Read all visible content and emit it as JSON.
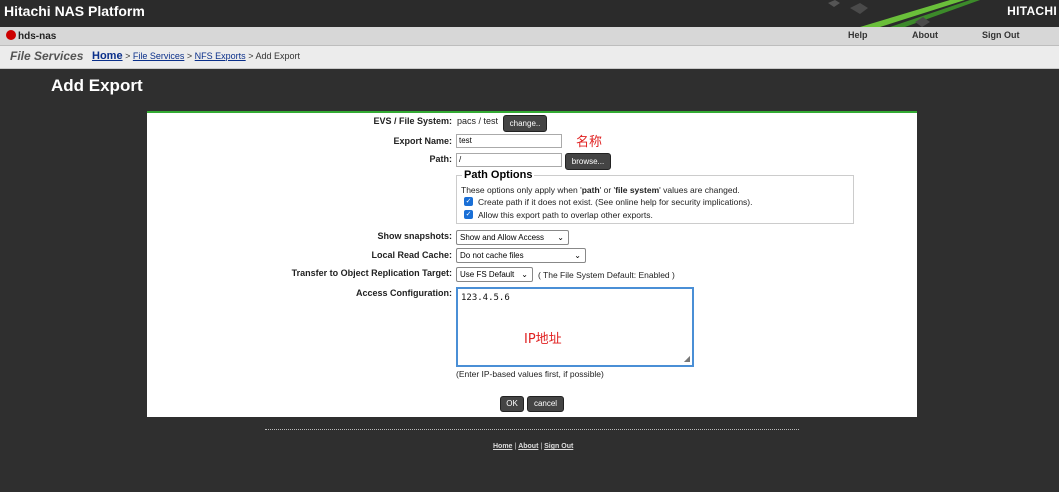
{
  "app": {
    "title": "Hitachi NAS Platform",
    "brand": "HITACHI"
  },
  "nav": {
    "server": "hds-nas",
    "help": "Help",
    "about": "About",
    "signout": "Sign Out"
  },
  "breadcrumb": {
    "section": "File Services",
    "home": "Home",
    "file_services": "File Services",
    "nfs_exports": "NFS Exports",
    "current": "Add Export",
    "sep": ">"
  },
  "page": {
    "title": "Add Export"
  },
  "form": {
    "evs_label": "EVS / File System:",
    "evs_value": "pacs /  test",
    "change_button": "change..",
    "export_name_label": "Export Name:",
    "export_name_value": "test",
    "export_name_annotation": "名称",
    "path_label": "Path:",
    "path_value": "/",
    "browse_button": "browse...",
    "path_options": {
      "legend": "Path Options",
      "note_before": "These options only apply when '",
      "note_path": "path",
      "note_mid": "' or '",
      "note_fs": "file system",
      "note_after": "' values are changed.",
      "create_path": "Create path if it does not exist. (See online help for security implications).",
      "create_path_checked": true,
      "allow_overlap": "Allow this export path to overlap other exports.",
      "allow_overlap_checked": true
    },
    "snapshots_label": "Show snapshots:",
    "snapshots_value": "Show and Allow Access",
    "read_cache_label": "Local Read Cache:",
    "read_cache_value": "Do not cache files",
    "replication_label": "Transfer to Object Replication Target:",
    "replication_value": "Use FS Default",
    "replication_note": "( The File System Default: Enabled )",
    "access_label": "Access Configuration:",
    "access_value": "123.4.5.6",
    "access_annotation": "IP地址",
    "access_hint": "(Enter IP-based values first, if possible)",
    "ok_button": "OK",
    "cancel_button": "cancel"
  },
  "footer": {
    "home": "Home",
    "about": "About",
    "signout": "Sign Out",
    "sep": "|"
  },
  "colors": {
    "accent": "#33aa33",
    "annotation": "#e02020",
    "focus": "#4a8fd6"
  }
}
